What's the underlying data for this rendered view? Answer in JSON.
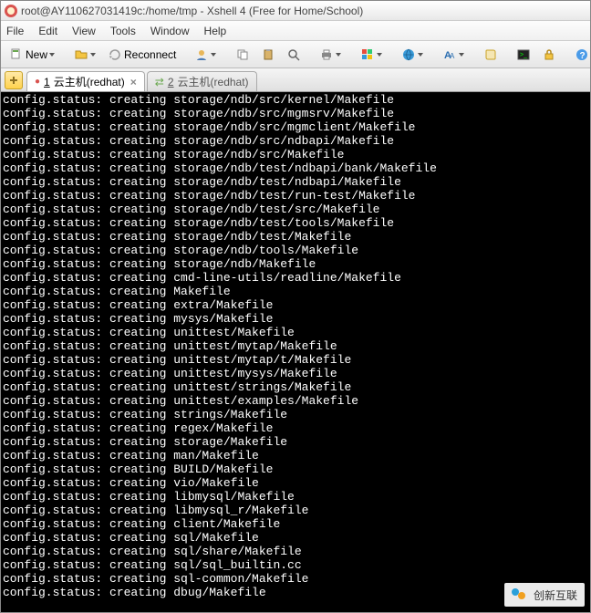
{
  "window": {
    "title": "root@AY110627031419c:/home/tmp - Xshell 4 (Free for Home/School)"
  },
  "menu": {
    "file": "File",
    "edit": "Edit",
    "view": "View",
    "tools": "Tools",
    "window": "Window",
    "help": "Help"
  },
  "toolbar": {
    "new_label": "New",
    "reconnect_label": "Reconnect"
  },
  "tabs": {
    "tab1_index": "1",
    "tab1_label": "云主机(redhat)",
    "tab2_index": "2",
    "tab2_label": "云主机(redhat)"
  },
  "watermark": {
    "text": "创新互联"
  },
  "terminal_lines": [
    "config.status: creating storage/ndb/src/kernel/Makefile",
    "config.status: creating storage/ndb/src/mgmsrv/Makefile",
    "config.status: creating storage/ndb/src/mgmclient/Makefile",
    "config.status: creating storage/ndb/src/ndbapi/Makefile",
    "config.status: creating storage/ndb/src/Makefile",
    "config.status: creating storage/ndb/test/ndbapi/bank/Makefile",
    "config.status: creating storage/ndb/test/ndbapi/Makefile",
    "config.status: creating storage/ndb/test/run-test/Makefile",
    "config.status: creating storage/ndb/test/src/Makefile",
    "config.status: creating storage/ndb/test/tools/Makefile",
    "config.status: creating storage/ndb/test/Makefile",
    "config.status: creating storage/ndb/tools/Makefile",
    "config.status: creating storage/ndb/Makefile",
    "config.status: creating cmd-line-utils/readline/Makefile",
    "config.status: creating Makefile",
    "config.status: creating extra/Makefile",
    "config.status: creating mysys/Makefile",
    "config.status: creating unittest/Makefile",
    "config.status: creating unittest/mytap/Makefile",
    "config.status: creating unittest/mytap/t/Makefile",
    "config.status: creating unittest/mysys/Makefile",
    "config.status: creating unittest/strings/Makefile",
    "config.status: creating unittest/examples/Makefile",
    "config.status: creating strings/Makefile",
    "config.status: creating regex/Makefile",
    "config.status: creating storage/Makefile",
    "config.status: creating man/Makefile",
    "config.status: creating BUILD/Makefile",
    "config.status: creating vio/Makefile",
    "config.status: creating libmysql/Makefile",
    "config.status: creating libmysql_r/Makefile",
    "config.status: creating client/Makefile",
    "config.status: creating sql/Makefile",
    "config.status: creating sql/share/Makefile",
    "config.status: creating sql/sql_builtin.cc",
    "config.status: creating sql-common/Makefile",
    "config.status: creating dbug/Makefile"
  ]
}
